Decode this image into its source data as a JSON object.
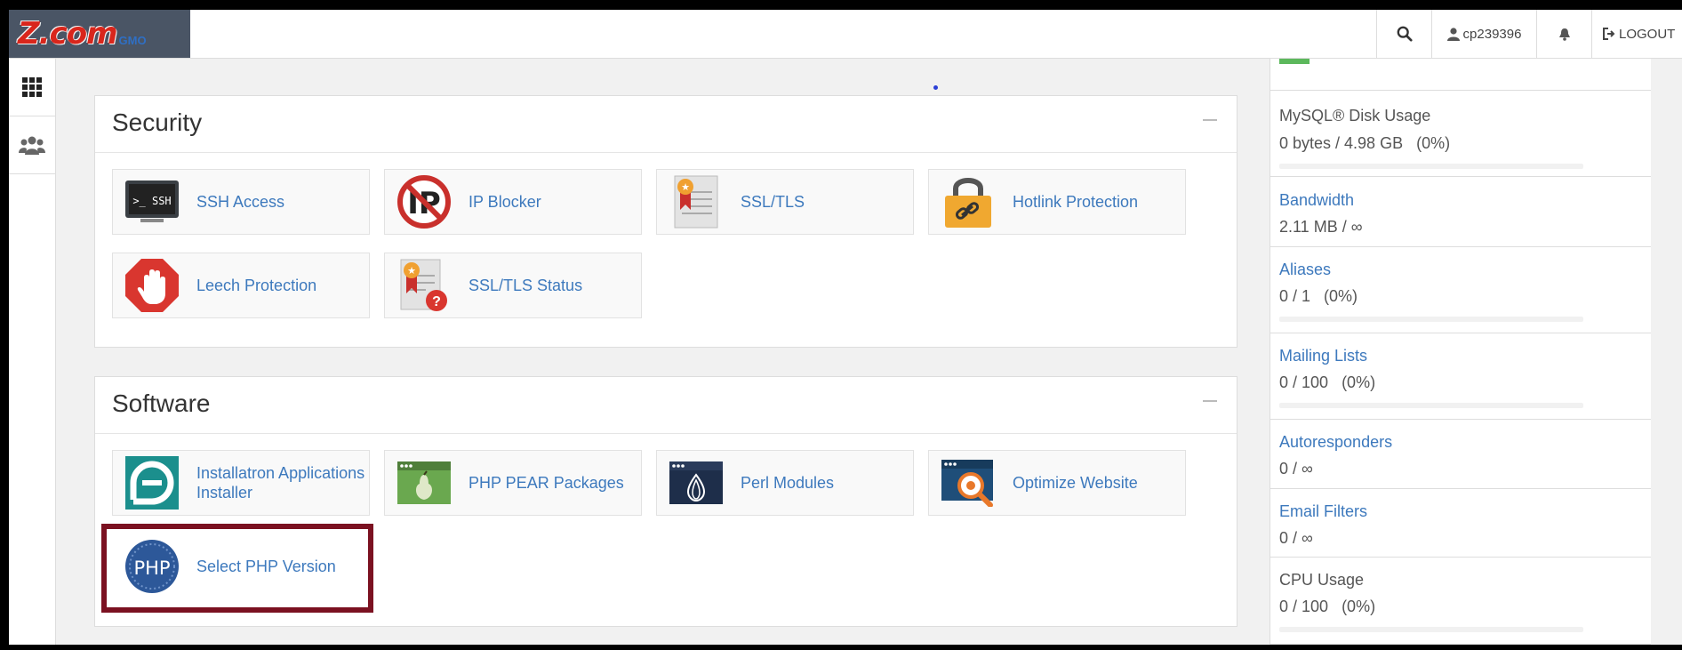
{
  "topbar": {
    "brand": "Z.com",
    "brand_sub": "GMO",
    "username": "cp239396",
    "logout": "LOGOUT"
  },
  "security": {
    "title": "Security",
    "items": [
      {
        "label": "SSH Access",
        "icon": "ssh-terminal-icon"
      },
      {
        "label": "IP Blocker",
        "icon": "ip-blocker-icon"
      },
      {
        "label": "SSL/TLS",
        "icon": "certificate-icon"
      },
      {
        "label": "Hotlink Protection",
        "icon": "padlock-link-icon"
      },
      {
        "label": "Leech Protection",
        "icon": "stop-hand-icon"
      },
      {
        "label": "SSL/TLS Status",
        "icon": "certificate-question-icon"
      }
    ]
  },
  "software": {
    "title": "Software",
    "items": [
      {
        "label": "Installatron Applications Installer",
        "icon": "installatron-icon"
      },
      {
        "label": "PHP PEAR Packages",
        "icon": "pear-package-icon"
      },
      {
        "label": "Perl Modules",
        "icon": "perl-onion-icon"
      },
      {
        "label": "Optimize Website",
        "icon": "optimize-gear-icon"
      },
      {
        "label": "Select PHP Version",
        "icon": "php-icon"
      }
    ]
  },
  "stats": [
    {
      "name": "MySQL® Disk Usage",
      "value": "0 bytes / 4.98 GB",
      "pct": "(0%)",
      "link": false
    },
    {
      "name": "Bandwidth",
      "value": "2.11 MB / ∞",
      "pct": "",
      "link": true
    },
    {
      "name": "Aliases",
      "value": "0 / 1",
      "pct": "(0%)",
      "link": true
    },
    {
      "name": "Mailing Lists",
      "value": "0 / 100",
      "pct": "(0%)",
      "link": true
    },
    {
      "name": "Autoresponders",
      "value": "0 / ∞",
      "pct": "",
      "link": true
    },
    {
      "name": "Email Filters",
      "value": "0 / ∞",
      "pct": "",
      "link": true
    },
    {
      "name": "CPU Usage",
      "value": "0 / 100",
      "pct": "(0%)",
      "link": false
    }
  ],
  "colors": {
    "link": "#3d79bd",
    "highlight": "#7b1121",
    "accent_green": "#5cb85c"
  }
}
